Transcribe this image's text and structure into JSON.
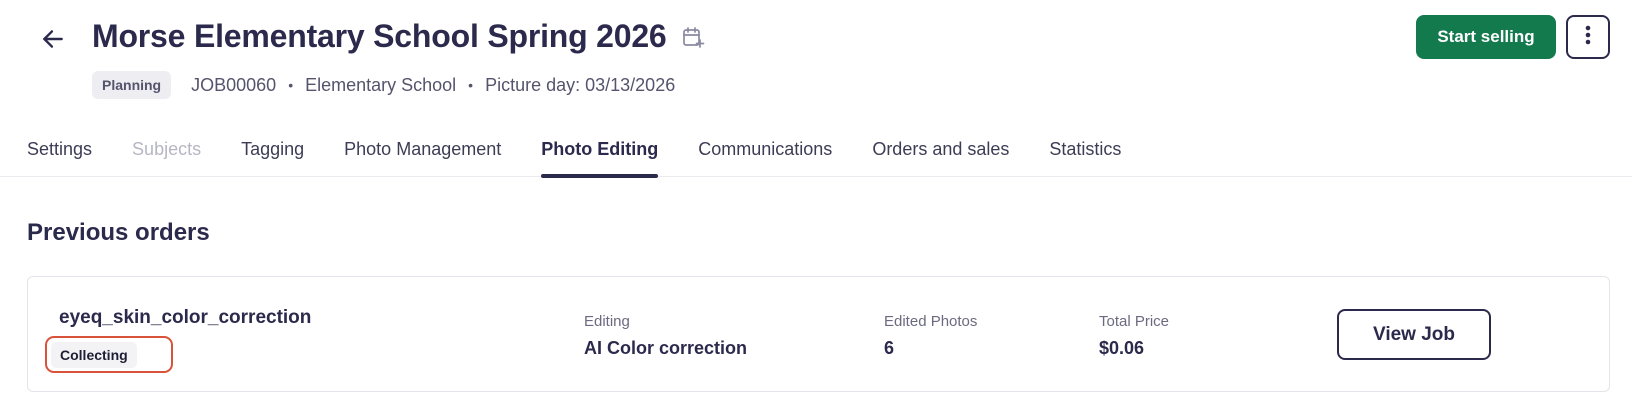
{
  "header": {
    "title": "Morse Elementary School Spring 2026",
    "status": "Planning",
    "job_id": "JOB00060",
    "school_type": "Elementary School",
    "picture_day": "Picture day: 03/13/2026",
    "separator": "•",
    "icons": {
      "back": "arrow-left-icon",
      "calendar": "calendar-add-icon",
      "more": "more-vertical-icon"
    }
  },
  "actions": {
    "start_selling_label": "Start selling"
  },
  "tabs": [
    {
      "label": "Settings",
      "state": "default"
    },
    {
      "label": "Subjects",
      "state": "disabled"
    },
    {
      "label": "Tagging",
      "state": "default"
    },
    {
      "label": "Photo Management",
      "state": "default"
    },
    {
      "label": "Photo Editing",
      "state": "active"
    },
    {
      "label": "Communications",
      "state": "default"
    },
    {
      "label": "Orders and sales",
      "state": "default"
    },
    {
      "label": "Statistics",
      "state": "default"
    }
  ],
  "previous_orders": {
    "title": "Previous orders",
    "orders": [
      {
        "name": "eyeq_skin_color_correction",
        "status": "Collecting",
        "editing_label": "Editing",
        "editing_value": "AI Color correction",
        "edited_photos_label": "Edited Photos",
        "edited_photos_value": "6",
        "total_price_label": "Total Price",
        "total_price_value": "$0.06",
        "view_label": "View Job"
      }
    ]
  },
  "colors": {
    "primary_text": "#2b2a4c",
    "brand_green": "#137a4e",
    "highlight_red": "#d9533b",
    "disabled_text": "#b7b6c4"
  }
}
